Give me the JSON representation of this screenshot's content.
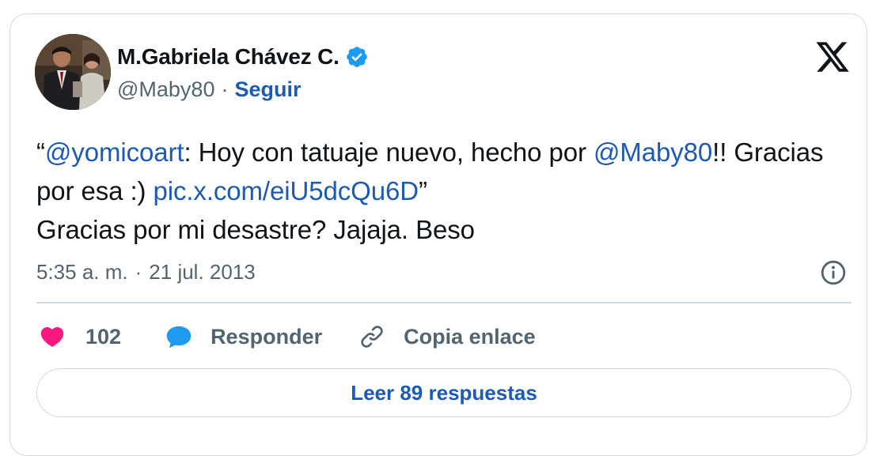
{
  "user": {
    "display_name": "M.Gabriela Chávez C.",
    "handle": "@Maby80",
    "separator": "·",
    "follow_label": "Seguir",
    "verified": true
  },
  "tweet": {
    "open_quote": "“",
    "mention_1": "@yomicoart",
    "text_1": ": Hoy con tatuaje nuevo, hecho por ",
    "mention_2": "@Maby80",
    "text_2": "!! Gracias por esa :) ",
    "media_link": "pic.x.com/eiU5dcQu6D",
    "close_quote": "”",
    "text_3": "Gracias por mi desastre? Jajaja. Beso"
  },
  "meta": {
    "time": "5:35 a. m.",
    "separator": "·",
    "date": "21 jul. 2013"
  },
  "actions": {
    "likes_count": "102",
    "reply_label": "Responder",
    "copy_link_label": "Copia enlace"
  },
  "read_replies_label": "Leer 89 respuestas",
  "icons": {
    "verified": "verified-badge-icon",
    "brand": "x-logo-icon",
    "info": "info-icon",
    "like": "heart-icon",
    "reply": "speech-bubble-icon",
    "copy": "link-icon"
  },
  "colors": {
    "link": "#1d5ab4",
    "verified": "#1d9bf0",
    "heart": "#f91880",
    "secondary_text": "#536471",
    "border": "#cfd9de"
  }
}
